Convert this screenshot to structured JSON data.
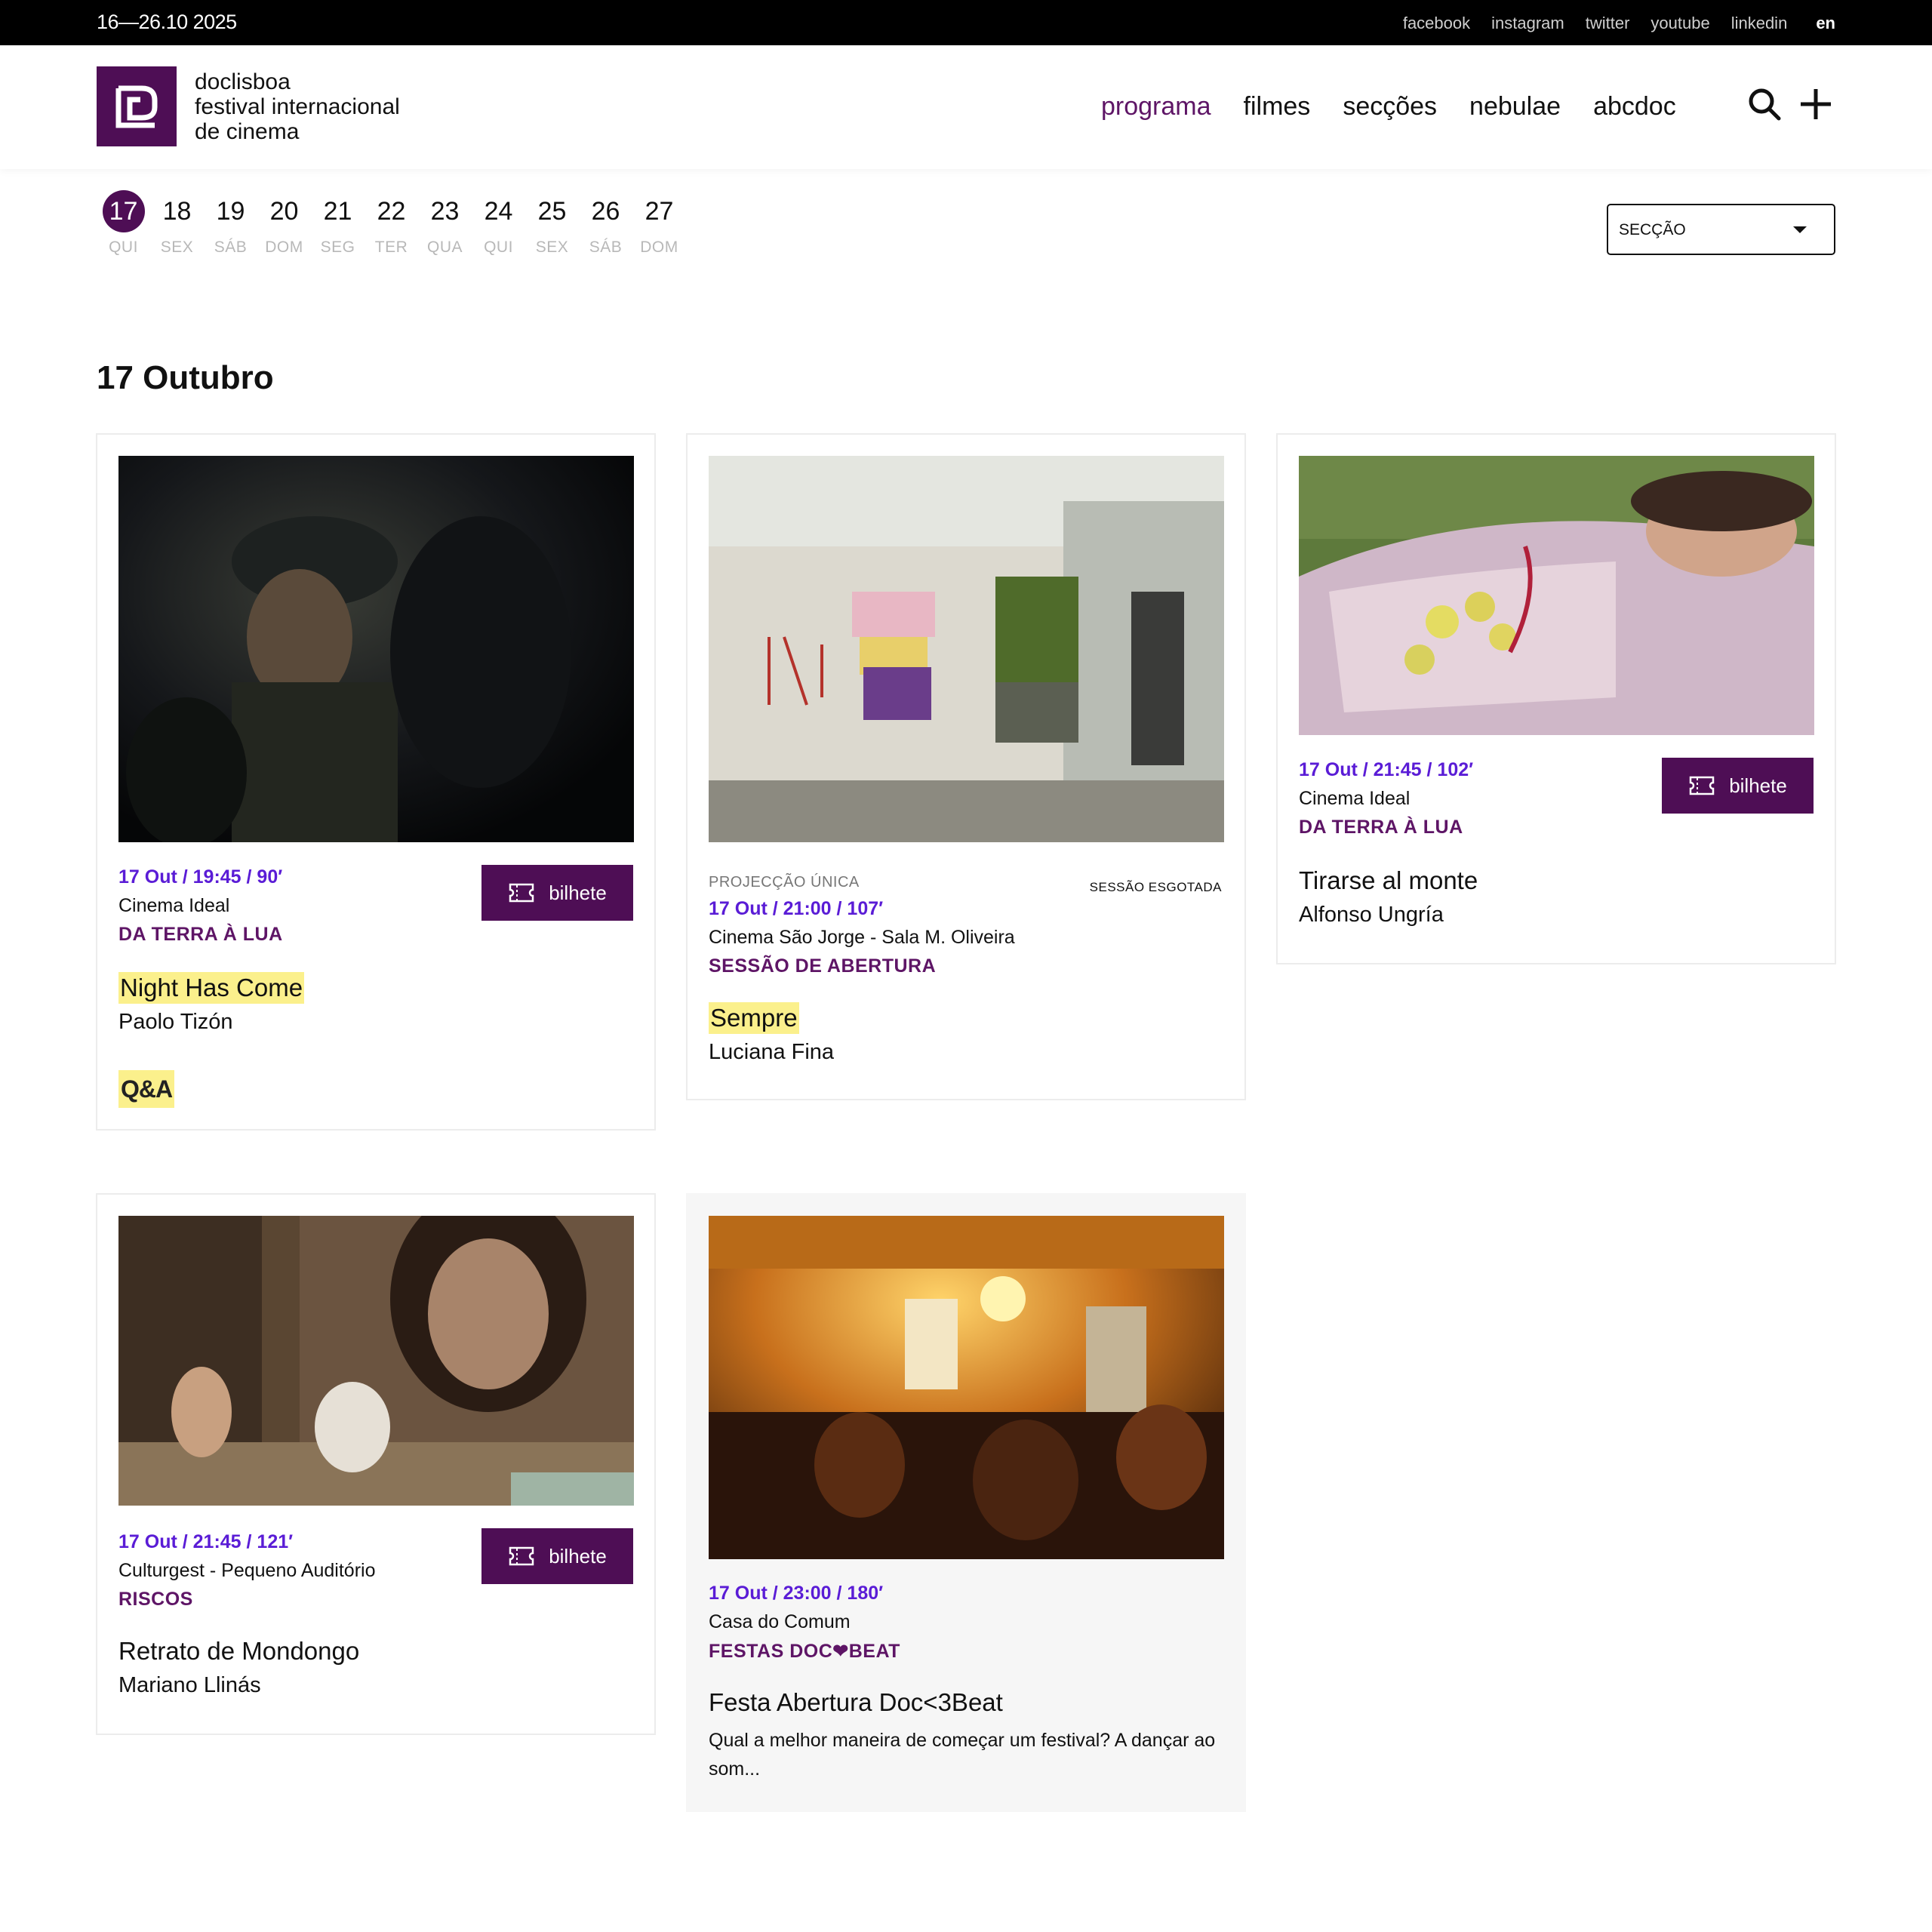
{
  "topbar": {
    "dates": "16—26.10 2025",
    "social": [
      "facebook",
      "instagram",
      "twitter",
      "youtube",
      "linkedin"
    ],
    "language": "en"
  },
  "header": {
    "logo_lines": [
      "doclisboa",
      "festival internacional",
      "de cinema"
    ],
    "nav": [
      "programa",
      "filmes",
      "secções",
      "nebulae",
      "abcdoc"
    ],
    "nav_active": "programa",
    "brand_color": "#4e0e55"
  },
  "days": [
    {
      "num": "17",
      "wd": "QUI",
      "active": true
    },
    {
      "num": "18",
      "wd": "SEX"
    },
    {
      "num": "19",
      "wd": "SÁB"
    },
    {
      "num": "20",
      "wd": "DOM"
    },
    {
      "num": "21",
      "wd": "SEG"
    },
    {
      "num": "22",
      "wd": "TER"
    },
    {
      "num": "23",
      "wd": "QUA"
    },
    {
      "num": "24",
      "wd": "QUI"
    },
    {
      "num": "25",
      "wd": "SEX"
    },
    {
      "num": "26",
      "wd": "SÁB"
    },
    {
      "num": "27",
      "wd": "DOM"
    }
  ],
  "filter": {
    "label": "SECÇÃO"
  },
  "day_title": "17 Outubro",
  "ticket_label": "bilhete",
  "cards": [
    {
      "time": "17 Out / 19:45 / 90′",
      "venue": "Cinema Ideal",
      "section": "DA TERRA À LUA",
      "title": "Night Has Come",
      "director": "Paolo Tizón",
      "badge": "Q&A"
    },
    {
      "pre_label": "PROJECÇÃO ÚNICA",
      "status": "SESSÃO ESGOTADA",
      "time": "17 Out / 21:00 / 107′",
      "venue": "Cinema São Jorge - Sala M. Oliveira",
      "section": "SESSÃO DE ABERTURA",
      "title": "Sempre",
      "director": "Luciana Fina"
    },
    {
      "time": "17 Out / 21:45 / 102′",
      "venue": "Cinema Ideal",
      "section": "DA TERRA À LUA",
      "title": "Tirarse al monte",
      "director": "Alfonso Ungría"
    },
    {
      "time": "17 Out / 21:45 / 121′",
      "venue": "Culturgest - Pequeno Auditório",
      "section": "RISCOS",
      "title": "Retrato de Mondongo",
      "director": "Mariano Llinás"
    },
    {
      "time": "17 Out / 23:00 / 180′",
      "venue": "Casa do Comum",
      "section": "FESTAS DOC❤BEAT",
      "title": "Festa Abertura Doc<3Beat",
      "description": "Qual a melhor maneira de começar um festival? A dançar ao som..."
    }
  ]
}
